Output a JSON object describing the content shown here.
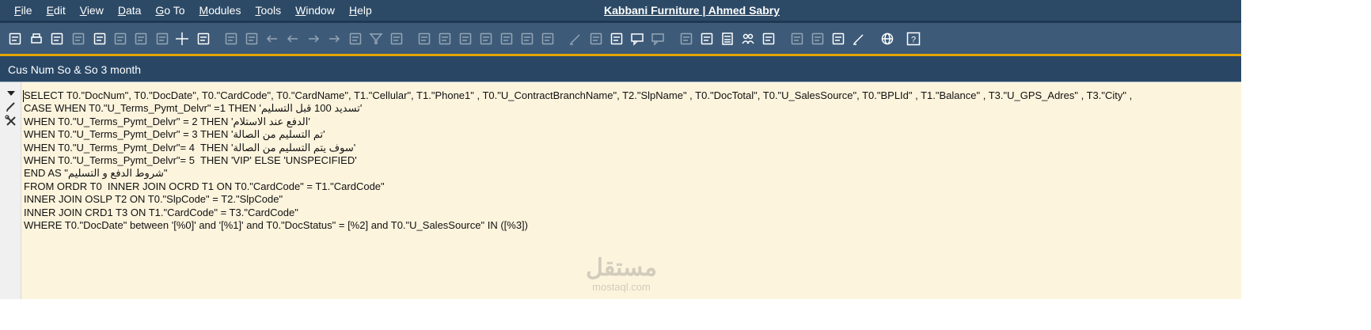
{
  "menubar": {
    "items": [
      "File",
      "Edit",
      "View",
      "Data",
      "Go To",
      "Modules",
      "Tools",
      "Window",
      "Help"
    ],
    "mnemonics": [
      "F",
      "E",
      "V",
      "D",
      "G",
      "M",
      "T",
      "W",
      "H"
    ],
    "rest": [
      "ile",
      "dit",
      "iew",
      "ata",
      "o To",
      "odules",
      "ools",
      "indow",
      "elp"
    ]
  },
  "app_title": "Kabbani Furniture | Ahmed Sabry",
  "window": {
    "title": "Cus Num So & So 3 month"
  },
  "toolbar": {
    "buttons": [
      "preview-icon",
      "print-icon",
      "calendar-icon",
      "copy-disabled-icon",
      "document-icon",
      "excel-icon",
      "word-icon",
      "pdf-icon",
      "move-icon",
      "lock-form-icon",
      "binoculars-icon",
      "goto-icon",
      "first-record-icon",
      "previous-record-icon",
      "next-record-icon",
      "last-record-icon",
      "refresh-icon",
      "filter-icon",
      "sort-icon",
      "base-document-icon",
      "target-document-icon",
      "settings-icon",
      "currency-icon",
      "balance-icon",
      "journal-icon",
      "query-icon",
      "edit-icon",
      "form-settings-icon",
      "udf-icon",
      "messages-icon",
      "reply-icon",
      "alert-icon",
      "time-icon",
      "calculator-icon",
      "users-icon",
      "stamp-icon",
      "drag-relate-icon",
      "layout-icon",
      "launch-icon",
      "signature-icon",
      "web-icon",
      "help-icon"
    ]
  },
  "editor": {
    "lines": [
      "SELECT T0.\"DocNum\", T0.\"DocDate\", T0.\"CardCode\", T0.\"CardName\", T1.\"Cellular\", T1.\"Phone1\" , T0.\"U_ContractBranchName\", T2.\"SlpName\" , T0.\"DocTotal\", T0.\"U_SalesSource\", T0.\"BPLId\" , T1.\"Balance\" , T3.\"U_GPS_Adres\" , T3.\"City\" ,",
      "CASE WHEN T0.\"U_Terms_Pymt_Delvr\" =1 THEN 'تسديد 100 قبل التسليم'",
      "WHEN T0.\"U_Terms_Pymt_Delvr\" = 2 THEN 'الدفع عند الاستلام'",
      "WHEN T0.\"U_Terms_Pymt_Delvr\" = 3 THEN 'تم التسليم من الصالة'",
      "WHEN T0.\"U_Terms_Pymt_Delvr\"= 4  THEN 'سوف يتم التسليم من الصالة'",
      "WHEN T0.\"U_Terms_Pymt_Delvr\"= 5  THEN 'VIP' ELSE 'UNSPECIFIED'",
      "END AS \"شروط الدفع و التسليم\"",
      "FROM ORDR T0  INNER JOIN OCRD T1 ON T0.\"CardCode\" = T1.\"CardCode\"",
      "INNER JOIN OSLP T2 ON T0.\"SlpCode\" = T2.\"SlpCode\"",
      "INNER JOIN CRD1 T3 ON T1.\"CardCode\" = T3.\"CardCode\"",
      "WHERE T0.\"DocDate\" between '[%0]' and '[%1]' and T0.\"DocStatus\" = [%2] and T0.\"U_SalesSource\" IN ([%3])"
    ]
  },
  "watermark": {
    "arabic": "مستقل",
    "latin": "mostaql.com"
  },
  "colors": {
    "menubar": "#2c4a66",
    "toolbar": "#3d5b78",
    "accent_stripe": "#e7a400",
    "window_header": "#294765",
    "editor_bg": "#fdf4dd"
  }
}
